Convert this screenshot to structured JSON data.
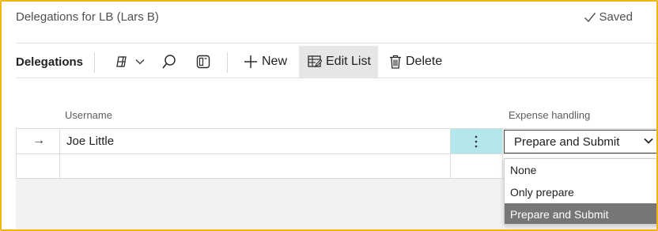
{
  "header": {
    "title": "Delegations for LB (Lars B)",
    "saved_label": "Saved"
  },
  "actionbar": {
    "title": "Delegations",
    "new_label": "New",
    "edit_list_label": "Edit List",
    "delete_label": "Delete"
  },
  "columns": {
    "username": "Username",
    "expense_handling": "Expense handling"
  },
  "rows": [
    {
      "username": "Joe Little",
      "expense_handling": "Prepare and Submit"
    },
    {
      "username": "",
      "expense_handling": ""
    }
  ],
  "dropdown": {
    "options": [
      "None",
      "Only prepare",
      "Prepare and Submit"
    ],
    "selected": "Prepare and Submit"
  },
  "colors": {
    "frame_border": "#f2b40e",
    "selected_cell": "#b3e7ec",
    "selected_option": "#767676",
    "grid_line": "#dcdcdc"
  }
}
